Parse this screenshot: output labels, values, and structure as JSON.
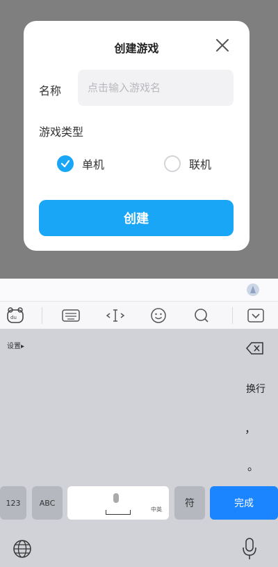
{
  "dialog": {
    "title": "创建游戏",
    "name_label": "名称",
    "name_placeholder": "点击输入游戏名",
    "name_value": "",
    "type_label": "游戏类型",
    "options": [
      {
        "label": "单机",
        "selected": true
      },
      {
        "label": "联机",
        "selected": false
      }
    ],
    "create_label": "创建",
    "accent_color": "#1aa6f7"
  },
  "keyboard": {
    "toolbar_icons": [
      "keyboard-brand-icon",
      "keyboard-layout-icon",
      "cursor-move-icon",
      "emoji-icon",
      "search-icon",
      "collapse-keyboard-icon"
    ],
    "settings_label": "设置▸",
    "enter_label": "换行",
    "comma": "，",
    "period": "。",
    "keys": {
      "num": "123",
      "abc": "ABC",
      "space_hint": "中英",
      "symbol": "符",
      "done": "完成"
    }
  }
}
